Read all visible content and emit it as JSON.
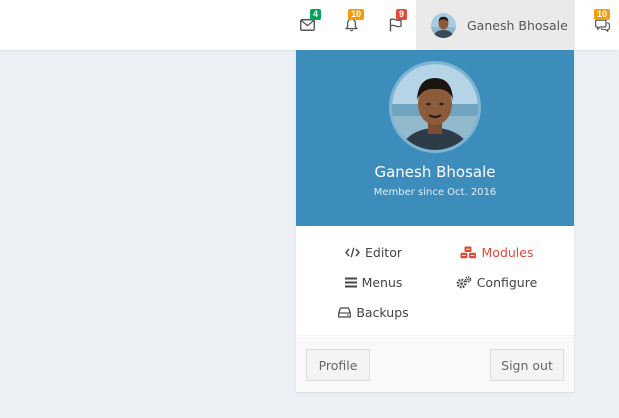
{
  "navbar": {
    "messages": {
      "icon": "envelope-icon",
      "count": "4",
      "badge_color": "#00a65a"
    },
    "notifications": {
      "icon": "bell-icon",
      "count": "10",
      "badge_color": "#f39c12"
    },
    "tasks": {
      "icon": "flag-icon",
      "count": "9",
      "badge_color": "#dd4b39"
    },
    "user_name": "Ganesh Bhosale",
    "chat": {
      "icon": "comments-icon",
      "count": "10",
      "badge_color": "#f39c12"
    }
  },
  "user_menu": {
    "header": {
      "name": "Ganesh Bhosale",
      "member_since": "Member since Oct. 2016",
      "background": "#3c8dbc"
    },
    "links": [
      {
        "label": "Editor",
        "icon": "code-icon"
      },
      {
        "label": "Modules",
        "icon": "cubes-icon",
        "color": "#dd4b39"
      },
      {
        "label": "Menus",
        "icon": "bars-icon"
      },
      {
        "label": "Configure",
        "icon": "cogs-icon"
      },
      {
        "label": "Backups",
        "icon": "hdd-icon"
      }
    ],
    "footer": {
      "profile_label": "Profile",
      "signout_label": "Sign out"
    }
  }
}
